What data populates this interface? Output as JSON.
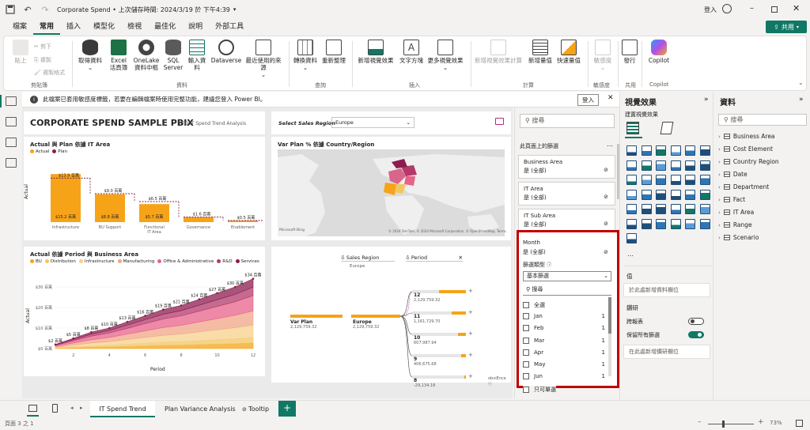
{
  "titlebar": {
    "title": "Corporate Spend • 上次儲存時間: 2024/3/19 於 下午4:39",
    "signin": "登入"
  },
  "menu": [
    "檔案",
    "常用",
    "插入",
    "模型化",
    "檢視",
    "最佳化",
    "說明",
    "外部工具"
  ],
  "share_label": "共用",
  "ribbon": {
    "clipboard": {
      "paste": "貼上",
      "cut": "剪下",
      "copy": "複製",
      "format_painter": "複製格式",
      "group": "剪貼簿"
    },
    "data": {
      "get_data": "取得資料",
      "excel": "Excel\n活頁簿",
      "onelake": "OneLake\n資料中樞",
      "sql": "SQL\nServer",
      "enter": "輸入資料",
      "dataverse": "Dataverse",
      "recent": "最近使用的來源",
      "group": "資料"
    },
    "queries": {
      "transform": "轉換資料",
      "refresh": "重新整理",
      "group": "查詢"
    },
    "insert": {
      "new_visual": "新增視覺效果",
      "textbox": "文字方塊",
      "more_visuals": "更多視覺效果",
      "group": "插入"
    },
    "calc": {
      "new_visual_calc": "新增視覺效果計算",
      "new_measure": "新增量值",
      "quick_measure": "快速量值",
      "group": "計算"
    },
    "sensitivity": {
      "label": "敏感度",
      "group": "敏感度"
    },
    "share": {
      "publish": "發行",
      "group": "共用"
    },
    "copilot": {
      "label": "Copilot",
      "group": "Copilot"
    }
  },
  "infobar": {
    "message": "此檔案已套用敏感度標籤，若要在編輯檔案時使用完整功能，建議您登入 Power BI。",
    "signin": "登入"
  },
  "report": {
    "title": "CORPORATE SPEND SAMPLE PBIX",
    "subtitle": "YTD IT Spend Trend Analysis",
    "region_label": "Select Sales Region",
    "region_value": "Europe",
    "chart1_title": "Actual 與 Plan 依據 IT Area",
    "chart1_legend": [
      "Actual",
      "Plan"
    ],
    "chart1_ylabel": "Actual",
    "chart2_title": "Var Plan % 依據 Country/Region",
    "chart2_credits": "© 2024 TomTom, © 2024 Microsoft Corporation, © OpenStreetMap, Terms",
    "chart2_logo": "Microsoft Bing",
    "chart3_title": "Actual 依據 Period 與 Business Area",
    "chart3_legend": [
      "BU",
      "Distribution",
      "Infrastructure",
      "Manufacturing",
      "Office & Administrative",
      "R&D",
      "Services"
    ],
    "chart3_ylabel": "Actual",
    "chart3_xlabel": "Period",
    "decomp": {
      "filter1_label": "Sales Region",
      "filter1_value": "Europe",
      "filter2_label": "Period",
      "root_label": "Var Plan",
      "root_value": "2,129,759.32",
      "node_label": "Europe",
      "node_value": "2,129,759.32",
      "items": [
        {
          "label": "12",
          "value": "2,129,759.32"
        },
        {
          "label": "11",
          "value": "1,161,729.70"
        },
        {
          "label": "10",
          "value": "607,987.94"
        },
        {
          "label": "9",
          "value": "406,675.68"
        },
        {
          "label": "8",
          "value": "-29,134.18"
        }
      ],
      "footer": "obviEnce ⓒ"
    }
  },
  "chart_data": [
    {
      "type": "bar",
      "title": "Actual 與 Plan 依據 IT Area",
      "categories": [
        "Infrastructure",
        "BU Support",
        "Functional IT Area",
        "Governance",
        "Enablement"
      ],
      "series": [
        {
          "name": "Actual",
          "values": [
            15.2,
            8.8,
            5.7,
            1.6,
            0.5
          ],
          "labels": [
            "$15.2 百萬",
            "$8.8 百萬",
            "$5.7 百萬",
            "",
            ""
          ]
        },
        {
          "name": "Plan",
          "values": [
            13.9,
            9.0,
            6.5,
            1.6,
            0.5
          ],
          "labels": [
            "$13.9 百萬",
            "$9.0 百萬",
            "$6.5 百萬",
            "$1.6 百萬",
            "$0.5 百萬"
          ]
        }
      ],
      "ylabel": "Actual",
      "colors": {
        "actual": "#f6a318",
        "plan": "#8c1c4f"
      }
    },
    {
      "type": "area",
      "title": "Actual 依據 Period 與 Business Area",
      "x": [
        1,
        2,
        3,
        4,
        5,
        6,
        7,
        8,
        9,
        10,
        11,
        12
      ],
      "totals": [
        2,
        5,
        8,
        10,
        13,
        16,
        19,
        21,
        24,
        27,
        30,
        34
      ],
      "total_labels": [
        "$2 百萬",
        "$5 百萬",
        "$8 百萬",
        "$10 百萬",
        "$13 百萬",
        "$16 百萬",
        "$19 百萬",
        "$21 百萬",
        "$24 百萬",
        "$27 百萬",
        "$30 百萬",
        "$34 百萬"
      ],
      "y_ticks": [
        "$0 百萬",
        "$10 百萬",
        "$20 百萬",
        "$30 百萬"
      ],
      "x_ticks": [
        "2",
        "4",
        "6",
        "8",
        "10",
        "12"
      ],
      "series": [
        {
          "name": "BU",
          "color": "#f6a318",
          "share": 0.08
        },
        {
          "name": "Distribution",
          "color": "#f3c65f",
          "share": 0.08
        },
        {
          "name": "Infrastructure",
          "color": "#f7d08a",
          "share": 0.18
        },
        {
          "name": "Manufacturing",
          "color": "#f1a587",
          "share": 0.2
        },
        {
          "name": "Office & Administrative",
          "color": "#e8628a",
          "share": 0.22
        },
        {
          "name": "R&D",
          "color": "#b33a6b",
          "share": 0.12
        },
        {
          "name": "Services",
          "color": "#8c1c4f",
          "share": 0.12
        }
      ],
      "ylabel": "Actual",
      "xlabel": "Period",
      "ylim": [
        0,
        35
      ]
    }
  ],
  "filters": {
    "search_placeholder": "搜尋",
    "section_title": "此頁面上的篩選",
    "cards": [
      {
        "name": "Business Area",
        "value": "是 (全部)"
      },
      {
        "name": "IT Area",
        "value": "是 (全部)"
      },
      {
        "name": "IT Sub Area",
        "value": "是 (全部)"
      }
    ],
    "month": {
      "name": "Month",
      "value": "是 (全部)",
      "type_label": "篩選類型",
      "type_value": "基本篩選",
      "search_placeholder": "搜尋",
      "items": [
        {
          "label": "全選",
          "count": ""
        },
        {
          "label": "Jan",
          "count": "1"
        },
        {
          "label": "Feb",
          "count": "1"
        },
        {
          "label": "Mar",
          "count": "1"
        },
        {
          "label": "Apr",
          "count": "1"
        },
        {
          "label": "May",
          "count": "1"
        },
        {
          "label": "Jun",
          "count": "1"
        }
      ],
      "single_select": "只可單選"
    }
  },
  "viz": {
    "title": "視覺效果",
    "build_label": "建置視覺效果",
    "values_label": "值",
    "values_placeholder": "於此處新增資料欄位",
    "drill_label": "鑽研",
    "cross_report": "跨報表",
    "keep_filters": "保留所有篩選",
    "drill_placeholder": "在此處新增鑽研欄位"
  },
  "data": {
    "title": "資料",
    "search_placeholder": "搜尋",
    "tables": [
      "Business Area",
      "Cost Element",
      "Country Region",
      "Date",
      "Department",
      "Fact",
      "IT Area",
      "Range",
      "Scenario"
    ]
  },
  "tabs": [
    "IT Spend Trend",
    "Plan Variance Analysis",
    "Tooltip"
  ],
  "status": {
    "page": "頁面 3 之 1",
    "zoom": "73%"
  },
  "accent": "#117865",
  "highlight": "#c00000"
}
